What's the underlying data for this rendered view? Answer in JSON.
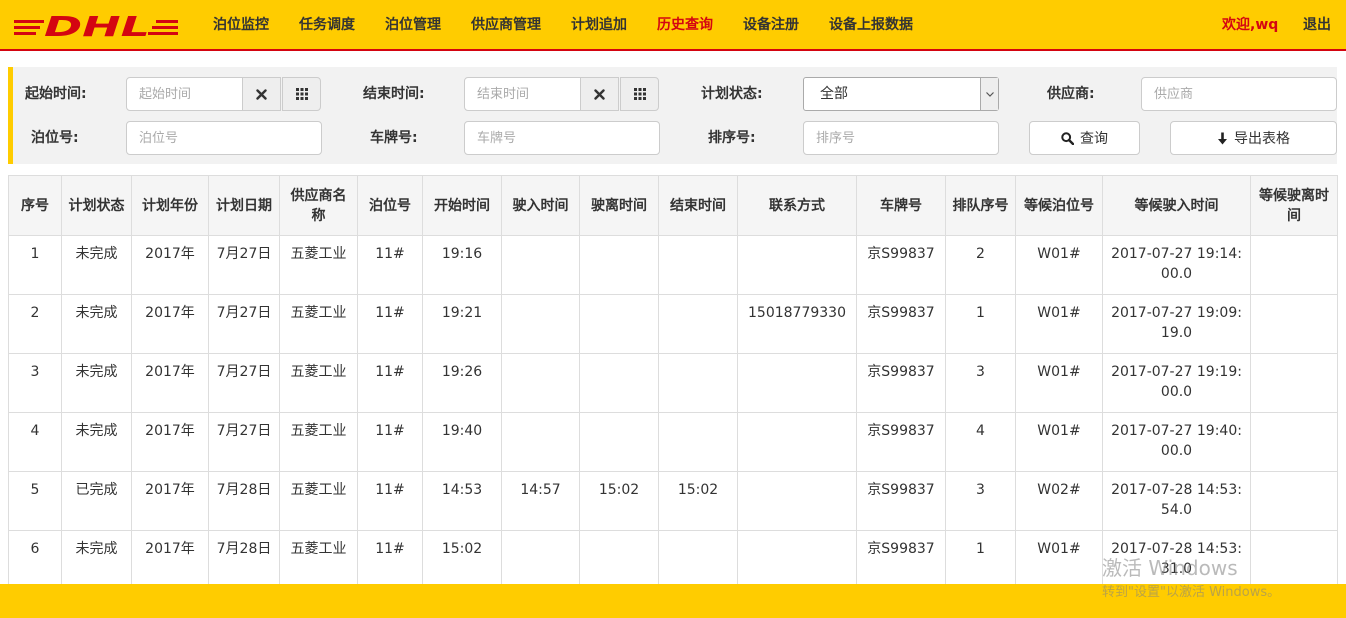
{
  "header": {
    "logo_text": "DHL",
    "brand_red": "#d40511",
    "brand_yellow": "#ffcc00",
    "nav": [
      {
        "label": "泊位监控",
        "active": false
      },
      {
        "label": "任务调度",
        "active": false
      },
      {
        "label": "泊位管理",
        "active": false
      },
      {
        "label": "供应商管理",
        "active": false
      },
      {
        "label": "计划追加",
        "active": false
      },
      {
        "label": "历史查询",
        "active": true
      },
      {
        "label": "设备注册",
        "active": false
      },
      {
        "label": "设备上报数据",
        "active": false
      }
    ],
    "welcome": "欢迎,wq",
    "logout": "退出"
  },
  "filter": {
    "start_label": "起始时间:",
    "start_placeholder": "起始时间",
    "end_label": "结束时间:",
    "end_placeholder": "结束时间",
    "status_label": "计划状态:",
    "status_value": "全部",
    "supplier_label": "供应商:",
    "supplier_placeholder": "供应商",
    "berth_label": "泊位号:",
    "berth_placeholder": "泊位号",
    "plate_label": "车牌号:",
    "plate_placeholder": "车牌号",
    "order_label": "排序号:",
    "order_placeholder": "排序号",
    "query_label": "查询",
    "export_label": "导出表格"
  },
  "table": {
    "headers": [
      "序号",
      "计划状态",
      "计划年份",
      "计划日期",
      "供应商名称",
      "泊位号",
      "开始时间",
      "驶入时间",
      "驶离时间",
      "结束时间",
      "联系方式",
      "车牌号",
      "排队序号",
      "等候泊位号",
      "等候驶入时间",
      "等候驶离时间"
    ],
    "rows": [
      [
        "1",
        "未完成",
        "2017年",
        "7月27日",
        "五菱工业",
        "11#",
        "19:16",
        "",
        "",
        "",
        "",
        "京S99837",
        "2",
        "W01#",
        "2017-07-27 19:14:00.0",
        ""
      ],
      [
        "2",
        "未完成",
        "2017年",
        "7月27日",
        "五菱工业",
        "11#",
        "19:21",
        "",
        "",
        "",
        "15018779330",
        "京S99837",
        "1",
        "W01#",
        "2017-07-27 19:09:19.0",
        ""
      ],
      [
        "3",
        "未完成",
        "2017年",
        "7月27日",
        "五菱工业",
        "11#",
        "19:26",
        "",
        "",
        "",
        "",
        "京S99837",
        "3",
        "W01#",
        "2017-07-27 19:19:00.0",
        ""
      ],
      [
        "4",
        "未完成",
        "2017年",
        "7月27日",
        "五菱工业",
        "11#",
        "19:40",
        "",
        "",
        "",
        "",
        "京S99837",
        "4",
        "W01#",
        "2017-07-27 19:40:00.0",
        ""
      ],
      [
        "5",
        "已完成",
        "2017年",
        "7月28日",
        "五菱工业",
        "11#",
        "14:53",
        "14:57",
        "15:02",
        "15:02",
        "",
        "京S99837",
        "3",
        "W02#",
        "2017-07-28 14:53:54.0",
        ""
      ],
      [
        "6",
        "未完成",
        "2017年",
        "7月28日",
        "五菱工业",
        "11#",
        "15:02",
        "",
        "",
        "",
        "",
        "京S99837",
        "1",
        "W01#",
        "2017-07-28 14:53:31.0",
        ""
      ]
    ]
  },
  "watermark": {
    "line1": "激活 Windows",
    "line2": "转到\"设置\"以激活 Windows。"
  }
}
